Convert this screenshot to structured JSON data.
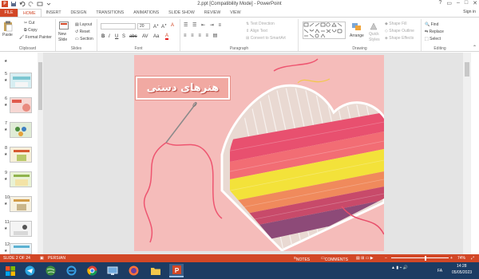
{
  "window": {
    "title": "2.ppt [Compatibility Mode] - PowerPoint",
    "app_icon": "P",
    "controls": [
      "?",
      "▭",
      "–",
      "□",
      "✕"
    ]
  },
  "tabs": [
    "FILE",
    "HOME",
    "INSERT",
    "DESIGN",
    "TRANSITIONS",
    "ANIMATIONS",
    "SLIDE SHOW",
    "REVIEW",
    "VIEW"
  ],
  "signin": "Sign in",
  "ribbon": {
    "clipboard": {
      "paste": "Paste",
      "cut": "Cut",
      "copy": "Copy",
      "format_painter": "Format Painter",
      "label": "Clipboard"
    },
    "slides": {
      "new_slide": "New",
      "new_slide_2": "Slide",
      "layout": "Layout",
      "reset": "Reset",
      "section": "Section",
      "label": "Slides"
    },
    "font": {
      "font_name": "",
      "font_size": "20",
      "label": "Font"
    },
    "paragraph": {
      "text_direction": "Text Direction",
      "align_text": "Align Text",
      "convert_smartart": "Convert to SmartArt",
      "label": "Paragraph"
    },
    "drawing": {
      "arrange": "Arrange",
      "quick_styles": "Quick",
      "quick_styles_2": "Styles",
      "shape_fill": "Shape Fill",
      "shape_outline": "Shape Outline",
      "shape_effects": "Shape Effects",
      "label": "Drawing"
    },
    "editing": {
      "find": "Find",
      "replace": "Replace",
      "select": "Select",
      "label": "Editing"
    }
  },
  "thumbnails": [
    {
      "num": "5"
    },
    {
      "num": "6"
    },
    {
      "num": "7"
    },
    {
      "num": "8"
    },
    {
      "num": "9"
    },
    {
      "num": "10"
    },
    {
      "num": "11"
    },
    {
      "num": "12"
    }
  ],
  "slide": {
    "title": "هنرهای دستی"
  },
  "status": {
    "slide_of": "SLIDE 2 OF 24",
    "language": "PERSIAN",
    "notes": "NOTES",
    "comments": "COMMENTS",
    "zoom": "74%"
  },
  "taskbar": {
    "lang": "FA",
    "time": "14:28",
    "date": "05/05/2023"
  },
  "colors": {
    "accent": "#d24726",
    "taskbar": "#1c3c63",
    "slide_bg": "#f4b8b6"
  }
}
